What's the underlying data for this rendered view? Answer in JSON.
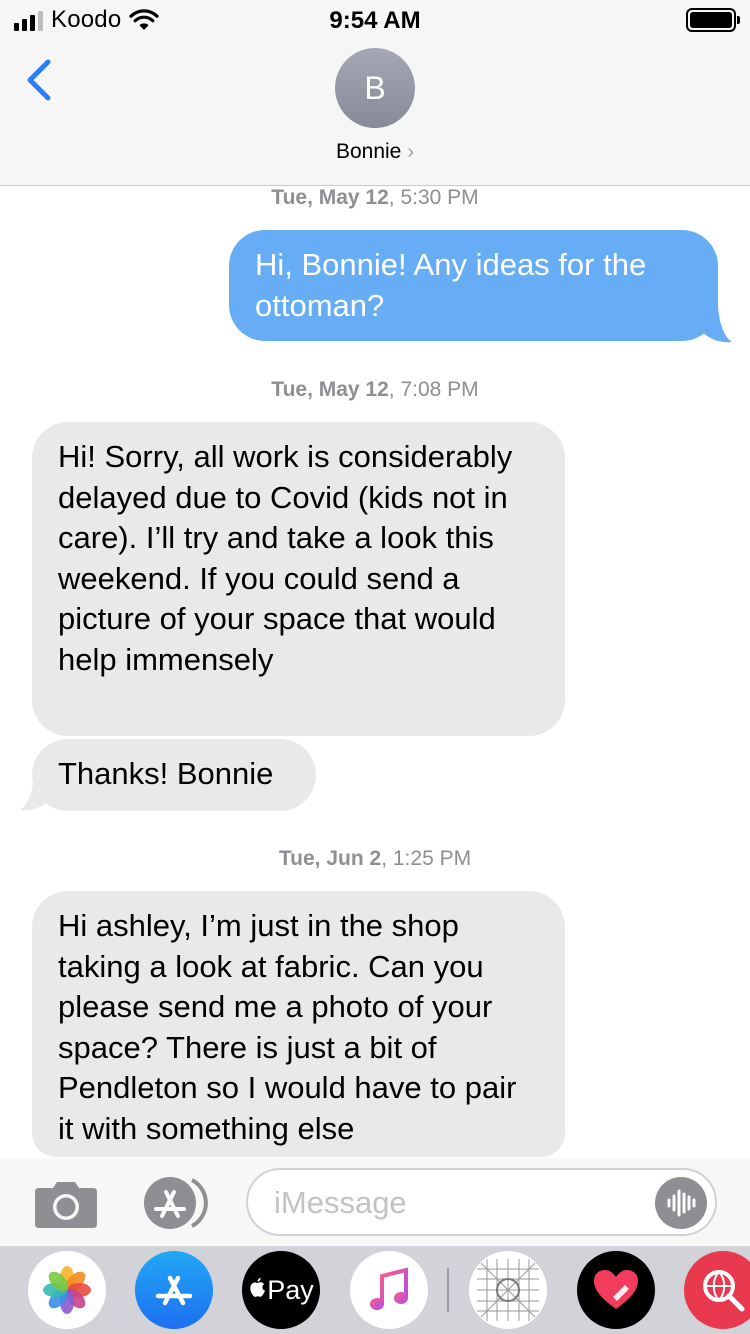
{
  "status_bar": {
    "carrier": "Koodo",
    "time": "9:54 AM"
  },
  "header": {
    "avatar_initial": "B",
    "contact_name": "Bonnie",
    "chevron": "›"
  },
  "messages": [
    {
      "type": "timestamp",
      "day": "Tue, May 12",
      "time": ", 5:30 PM"
    },
    {
      "type": "outgoing",
      "text": "Hi, Bonnie! Any ideas for the ottoman?"
    },
    {
      "type": "timestamp",
      "day": "Tue, May 12",
      "time": ", 7:08 PM"
    },
    {
      "type": "incoming",
      "text": "Hi! Sorry, all work is considerably delayed due to Covid (kids not in care). I’ll try and take a look this weekend. If you could send a picture of your space that would help immensely"
    },
    {
      "type": "incoming",
      "text": "Thanks! Bonnie"
    },
    {
      "type": "timestamp",
      "day": "Tue, Jun 2",
      "time": ", 1:25 PM"
    },
    {
      "type": "incoming",
      "text": "Hi ashley, I’m just in the shop taking a look at fabric. Can you please send me a photo of your space? There is just a bit of Pendleton so I would have to pair it with something else"
    }
  ],
  "input_bar": {
    "placeholder": "iMessage",
    "icons": [
      "camera-icon",
      "app-store-icon",
      "audio-message-icon"
    ]
  },
  "app_drawer": {
    "apps": [
      "photos",
      "app-store",
      "apple-pay",
      "music",
      "sketch",
      "digital-touch",
      "search-images"
    ],
    "apple_pay_label": "Pay"
  },
  "colors": {
    "outgoing_bubble": "#66adf5",
    "incoming_bubble": "#e9e9eb",
    "accent_blue": "#2e7cf6",
    "header_bg": "#f6f6f6",
    "drawer_bg": "#d1d3d9"
  }
}
